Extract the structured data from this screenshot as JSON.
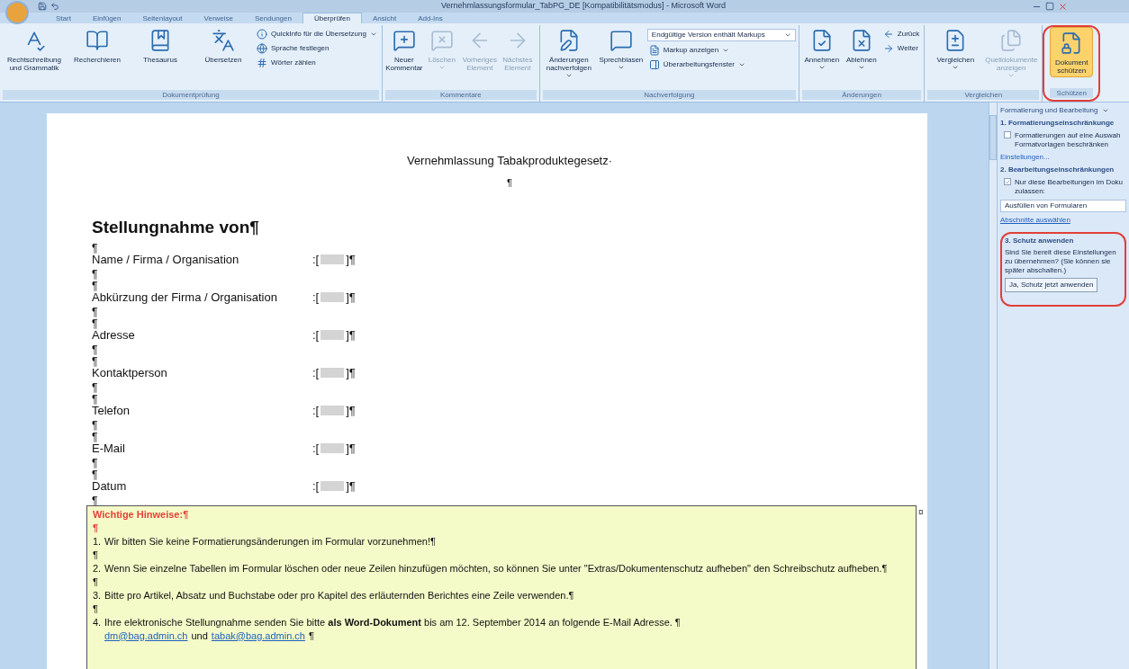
{
  "window": {
    "title": "Vernehmlassungsformular_TabPG_DE [Kompatibilitätsmodus] - Microsoft Word"
  },
  "tabs": [
    {
      "label": "Start",
      "selected": false
    },
    {
      "label": "Einfügen",
      "selected": false
    },
    {
      "label": "Seitenlayout",
      "selected": false
    },
    {
      "label": "Verweise",
      "selected": false
    },
    {
      "label": "Sendungen",
      "selected": false
    },
    {
      "label": "Überprüfen",
      "selected": true
    },
    {
      "label": "Ansicht",
      "selected": false
    },
    {
      "label": "Add-Ins",
      "selected": false
    }
  ],
  "ribbon": {
    "groups": [
      {
        "label": "Dokumentprüfung",
        "buttons": [
          {
            "kind": "large",
            "label": "Rechtschreibung und Grammatik",
            "disabled": false,
            "selected": false,
            "dropdown": false
          },
          {
            "kind": "large",
            "label": "Recherchieren",
            "disabled": false,
            "selected": false,
            "dropdown": false
          },
          {
            "kind": "large",
            "label": "Thesaurus",
            "disabled": false,
            "selected": false,
            "dropdown": false
          },
          {
            "kind": "large",
            "label": "Übersetzen",
            "disabled": false,
            "selected": false,
            "dropdown": false
          },
          {
            "kind": "small",
            "label": "QuickInfo für die Übersetzung",
            "disabled": false,
            "selected": false,
            "dropdown": true
          },
          {
            "kind": "small",
            "label": "Sprache festlegen",
            "disabled": false,
            "selected": false,
            "dropdown": false
          },
          {
            "kind": "small",
            "label": "Wörter zählen",
            "disabled": false,
            "selected": false,
            "dropdown": false
          }
        ]
      },
      {
        "label": "Kommentare",
        "buttons": [
          {
            "kind": "large",
            "label": "Neuer Kommentar",
            "disabled": false,
            "selected": false,
            "dropdown": false
          },
          {
            "kind": "large",
            "label": "Löschen",
            "disabled": true,
            "selected": false,
            "dropdown": true
          },
          {
            "kind": "large",
            "label": "Vorheriges Element",
            "disabled": true,
            "selected": false,
            "dropdown": false
          },
          {
            "kind": "large",
            "label": "Nächstes Element",
            "disabled": true,
            "selected": false,
            "dropdown": false
          }
        ]
      },
      {
        "label": "Nachverfolgung",
        "buttons": [
          {
            "kind": "large",
            "label": "Änderungen nachverfolgen",
            "disabled": false,
            "selected": false,
            "dropdown": true
          },
          {
            "kind": "large",
            "label": "Sprechblasen",
            "disabled": false,
            "selected": false,
            "dropdown": true
          },
          {
            "kind": "select",
            "label": "Endgültige Version enthält Markups",
            "disabled": false,
            "selected": false,
            "dropdown": true
          },
          {
            "kind": "small",
            "label": "Markup anzeigen",
            "disabled": false,
            "selected": false,
            "dropdown": true
          },
          {
            "kind": "small",
            "label": "Überarbeitungsfenster",
            "disabled": false,
            "selected": false,
            "dropdown": true
          }
        ]
      },
      {
        "label": "Änderungen",
        "buttons": [
          {
            "kind": "large",
            "label": "Annehmen",
            "disabled": false,
            "selected": false,
            "dropdown": true
          },
          {
            "kind": "large",
            "label": "Ablehnen",
            "disabled": false,
            "selected": false,
            "dropdown": true
          },
          {
            "kind": "small",
            "label": "Zurück",
            "disabled": false,
            "selected": false,
            "dropdown": false
          },
          {
            "kind": "small",
            "label": "Weiter",
            "disabled": false,
            "selected": false,
            "dropdown": false
          }
        ]
      },
      {
        "label": "Vergleichen",
        "buttons": [
          {
            "kind": "large",
            "label": "Vergleichen",
            "disabled": false,
            "selected": false,
            "dropdown": true
          },
          {
            "kind": "large",
            "label": "Quelldokumente anzeigen",
            "disabled": true,
            "selected": false,
            "dropdown": true
          }
        ]
      },
      {
        "label": "Schützen",
        "buttons": [
          {
            "kind": "large",
            "label": "Dokument schützen",
            "disabled": false,
            "selected": true,
            "dropdown": false
          }
        ]
      }
    ]
  },
  "document": {
    "title": "Vernehmlassung Tabakproduktegesetz·",
    "title_mark": "¶",
    "heading": "Stellungnahme von¶",
    "lines": [
      {
        "kind": "mark",
        "text": "¶"
      },
      {
        "kind": "field",
        "label": "Name / Firma / Organisation",
        "open": ":[",
        "close": "]¶"
      },
      {
        "kind": "mark",
        "text": "¶"
      },
      {
        "kind": "mark",
        "text": "¶"
      },
      {
        "kind": "field",
        "label": "Abkürzung der Firma / Organisation",
        "open": ":[",
        "close": "]¶"
      },
      {
        "kind": "mark",
        "text": "¶"
      },
      {
        "kind": "mark",
        "text": "¶"
      },
      {
        "kind": "field",
        "label": "Adresse",
        "open": ":[",
        "close": "]¶"
      },
      {
        "kind": "mark",
        "text": "¶"
      },
      {
        "kind": "mark",
        "text": "¶"
      },
      {
        "kind": "field",
        "label": "Kontaktperson",
        "open": ":[",
        "close": "]¶"
      },
      {
        "kind": "mark",
        "text": "¶"
      },
      {
        "kind": "mark",
        "text": "¶"
      },
      {
        "kind": "field",
        "label": "Telefon",
        "open": ":[",
        "close": "]¶"
      },
      {
        "kind": "mark",
        "text": "¶"
      },
      {
        "kind": "mark",
        "text": "¶"
      },
      {
        "kind": "field",
        "label": "E-Mail",
        "open": ":[",
        "close": "]¶"
      },
      {
        "kind": "mark",
        "text": "¶"
      },
      {
        "kind": "mark",
        "text": "¶"
      },
      {
        "kind": "field",
        "label": "Datum",
        "open": ":[",
        "close": "]¶"
      },
      {
        "kind": "mark",
        "text": "¶"
      }
    ],
    "notes": {
      "title": "Wichtige Hinweise:¶",
      "title_mark": "¶",
      "cell_mark": "¤",
      "items": [
        {
          "number": "1.",
          "text": "Wir bitten Sie keine Formatierungsänderungen im Formular vorzunehmen!¶",
          "mark": "¶"
        },
        {
          "number": "2.",
          "text": "Wenn Sie einzelne Tabellen im Formular löschen oder neue Zeilen hinzufügen möchten, so können Sie unter \"Extras/Dokumentenschutz aufheben\" den Schreibschutz aufheben.¶",
          "mark": "¶"
        },
        {
          "number": "3.",
          "text": "Bitte pro Artikel, Absatz und Buchstabe oder pro Kapitel des erläuternden Berichtes eine Zeile verwenden.¶",
          "mark": "¶"
        },
        {
          "number": "4.",
          "text": "Ihre elektronische Stellungnahme senden Sie bitte **als Word-Dokument** bis am 12. September 2014 an folgende E-Mail Adresse. ¶",
          "links": [
            "dm@bag.admin.ch",
            "tabak@bag.admin.ch"
          ],
          "joiner": "und",
          "end_mark": "¶"
        }
      ]
    }
  },
  "task_pane": {
    "title": "Formatierung und Bearbeitung",
    "section1": {
      "title": "1. Formatierungseinschränkunge",
      "option": {
        "label": "Formatierungen auf eine Auswah Formatvorlagen beschränken",
        "checked": false
      },
      "link": "Einstellungen..."
    },
    "section2": {
      "title": "2. Bearbeitungseinschränkungen",
      "option": {
        "label": "Nur diese Bearbeitungen im Doku zulassen:",
        "checked": true
      },
      "select": "Ausfüllen von Formularen",
      "link": "Abschnitte auswählen"
    },
    "section3": {
      "title": "3. Schutz anwenden",
      "text": "Sind Sie bereit diese Einstellungen zu übernehmen? (Sie können sie später abschalten.)",
      "button": "Ja, Schutz jetzt anwenden"
    }
  }
}
